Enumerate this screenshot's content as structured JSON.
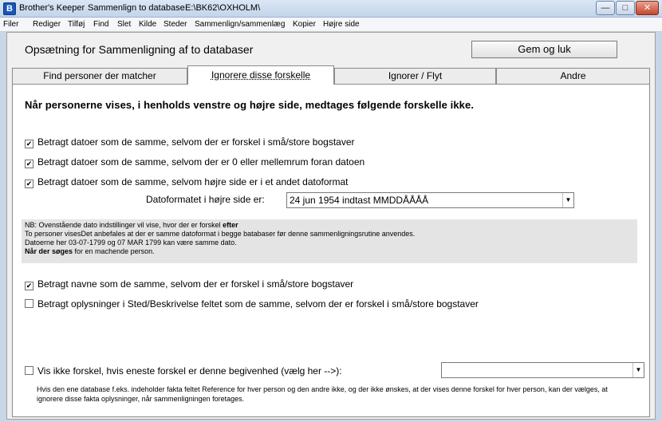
{
  "window": {
    "app_name": "Brother's Keeper",
    "module": "Sammenlign to database",
    "path": "E:\\BK62\\OXHOLM\\"
  },
  "menu": [
    "Filer",
    "Rediger",
    "Tilføj",
    "Find",
    "Slet",
    "Kilde",
    "Steder",
    "Sammenlign/sammenlæg",
    "Kopier",
    "Højre side"
  ],
  "header": {
    "title": "Opsætning for Sammenligning af to databaser",
    "save_label": "Gem og luk"
  },
  "tabs": [
    "Find personer der matcher",
    "Ignorere disse forskelle",
    "Ignorer / Flyt",
    "Andre"
  ],
  "active_tab": 1,
  "main": {
    "heading": "Når personerne vises, i henholds venstre og højre side, medtages følgende forskelle ikke.",
    "date_options": [
      {
        "label": "Betragt datoer som de samme, selvom der er forskel i små/store bogstaver",
        "checked": true
      },
      {
        "label": "Betragt datoer som de samme, selvom der er 0 eller mellemrum foran datoen",
        "checked": true
      },
      {
        "label": "Betragt datoer som de samme, selvom højre side er i et andet datoformat",
        "checked": true
      }
    ],
    "format_label": "Datoformatet i højre side er:",
    "format_value": "24 jun 1954 indtast MMDDÅÅÅÅ",
    "note": {
      "line1_a": "NB: Ovenstående dato indstillinger vil vise, hvor der er forskel",
      "line1_b": "efter",
      "line2": "To personer visesDet anbefales at der er samme datoformat i begge batabaser før denne sammenligningsrutine anvendes.",
      "line3": "Datoerne her 03-07-1799 og 07 MAR 1799 kan være samme dato.",
      "line4_a": "Når der søges",
      "line4_b": "for en machende person."
    },
    "name_options": [
      {
        "label": "Betragt navne som de samme, selvom der er forskel i små/store bogstaver",
        "checked": true
      },
      {
        "label": "Betragt oplysninger i Sted/Beskrivelse feltet som de samme, selvom der er forskel i små/store bogstaver",
        "checked": false
      }
    ],
    "event_option": {
      "label": "Vis ikke forskel, hvis eneste forskel er denne begivenhed (vælg her -->):",
      "checked": false
    },
    "event_value": "",
    "help_text": "Hvis den ene database f.eks. indeholder fakta feltet Reference for hver person og den andre ikke, og der ikke ønskes, at der vises denne forskel for hver person, kan der vælges, at ignorere disse fakta oplysninger, når sammenligningen foretages."
  }
}
